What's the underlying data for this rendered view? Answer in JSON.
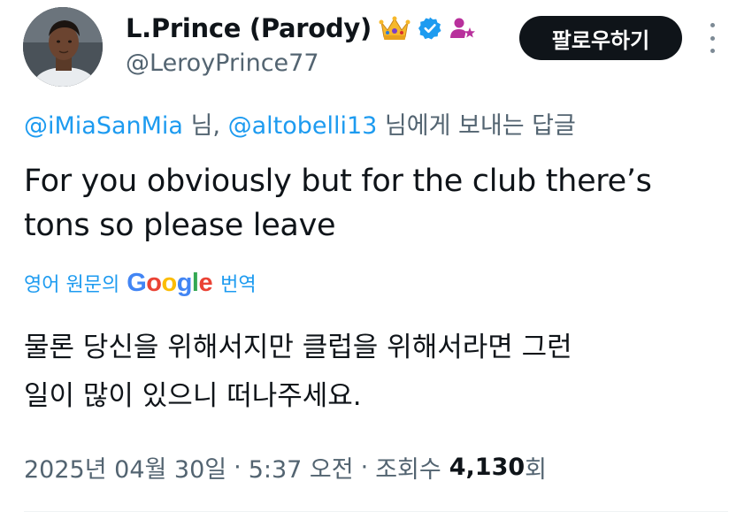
{
  "author": {
    "display_name": "L.Prince (Parody)",
    "handle": "@LeroyPrince77",
    "badges": [
      "crown-icon",
      "verified-badge-icon",
      "affiliate-person-star-icon"
    ]
  },
  "follow_button": {
    "label": "팔로우하기"
  },
  "more_options": {
    "icon": "more-vertical-icon"
  },
  "reply_context": {
    "mention_1": "@iMiaSanMia",
    "joiner_1": " 님, ",
    "mention_2": "@altobelli13",
    "suffix": " 님에게 보내는 답글"
  },
  "tweet": {
    "text_line_1": "For you obviously but for the club there’s",
    "text_line_2": "tons so please leave"
  },
  "translation": {
    "prefix": "영어 원문의",
    "brand": "Google",
    "suffix": "번역",
    "text_line_1": "물론 당신을 위해서지만 클럽을 위해서라면 그런",
    "text_line_2": "일이 많이 있으니 떠나주세요."
  },
  "meta": {
    "date": "2025년 04월 30일",
    "time": "5:37 오전",
    "views_prefix": "조회수",
    "views_count": "4,130",
    "views_suffix": "회"
  },
  "colors": {
    "link_blue": "#1d9bf0",
    "secondary_text": "#536471",
    "primary_text": "#0f1419",
    "button_bg": "#0f1419"
  }
}
